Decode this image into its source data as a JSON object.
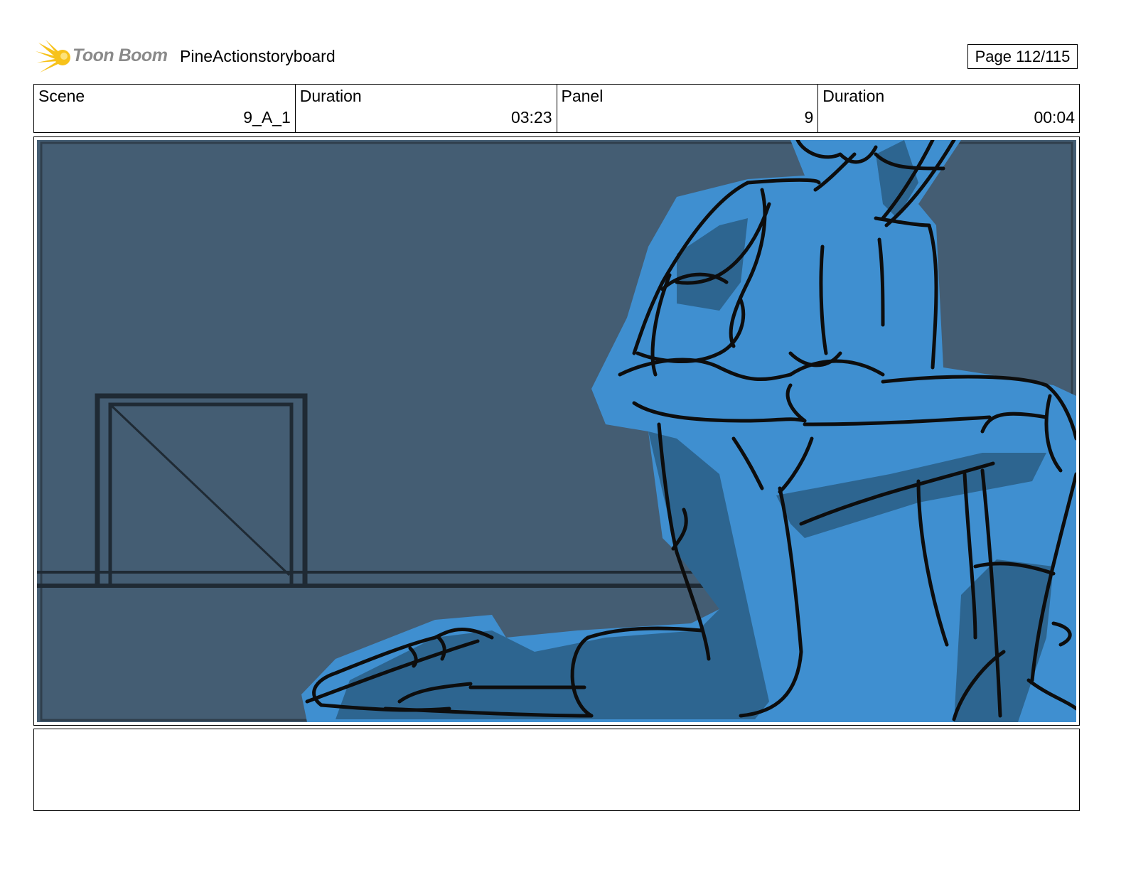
{
  "header": {
    "logo_text": "Toon Boom",
    "project_name": "PineActionstoryboard",
    "page_label": "Page 112/115"
  },
  "info_row": {
    "scene_label": "Scene",
    "scene_value": "9_A_1",
    "scene_duration_label": "Duration",
    "scene_duration_value": "03:23",
    "panel_label": "Panel",
    "panel_value": "9",
    "panel_duration_label": "Duration",
    "panel_duration_value": "00:04"
  },
  "colors": {
    "background_wall": "#445d73",
    "figure_fill": "#3f8fd0",
    "figure_shadow": "#2d6590",
    "line": "#0d0d0d",
    "logo_yellow": "#f7c21a"
  },
  "notes": ""
}
